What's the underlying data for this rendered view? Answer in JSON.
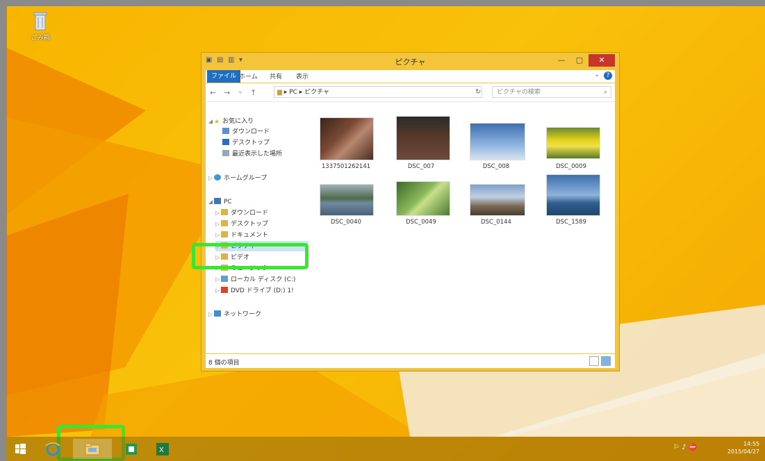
{
  "desktop": {
    "recycle_bin_label": "ごみ箱"
  },
  "window": {
    "title": "ピクチャ",
    "qat_icons": [
      "folder-icon",
      "properties-icon",
      "new-folder-icon",
      "dropdown-icon"
    ],
    "controls": {
      "minimize": "—",
      "maximize": "▢",
      "close": "✕"
    },
    "ribbon": {
      "tabs": [
        "ファイル",
        "ホーム",
        "共有",
        "表示"
      ],
      "caret": "⌄",
      "help": "?"
    },
    "address": {
      "back": "←",
      "forward": "→",
      "recent": "⌄",
      "up": "↑",
      "path": "▸ PC ▸ ピクチャ",
      "refresh": "↻",
      "search_placeholder": "ピクチャの検索",
      "search_glyph": "⌕"
    },
    "nav_pane": {
      "favorites": "お気に入り",
      "favorites_items": [
        "ダウンロード",
        "デスクトップ",
        "最近表示した場所"
      ],
      "homegroup": "ホームグループ",
      "pc": "PC",
      "pc_items": [
        "ダウンロード",
        "デスクトップ",
        "ドキュメント",
        "ピクチャ",
        "ビデオ",
        "ミュージック",
        "ローカル ディスク (C:)",
        "DVD ドライブ (D:) 1!"
      ],
      "network": "ネットワーク"
    },
    "files": [
      {
        "name": "1337501262141"
      },
      {
        "name": "DSC_007"
      },
      {
        "name": "DSC_008"
      },
      {
        "name": "DSC_0009"
      },
      {
        "name": "DSC_0040"
      },
      {
        "name": "DSC_0049"
      },
      {
        "name": "DSC_0144"
      },
      {
        "name": "DSC_1589"
      }
    ],
    "status": "8 個の項目"
  },
  "taskbar": {
    "tray": "⚐ ♪ ⛔",
    "time": "14:55",
    "date": "2015/04/27"
  }
}
